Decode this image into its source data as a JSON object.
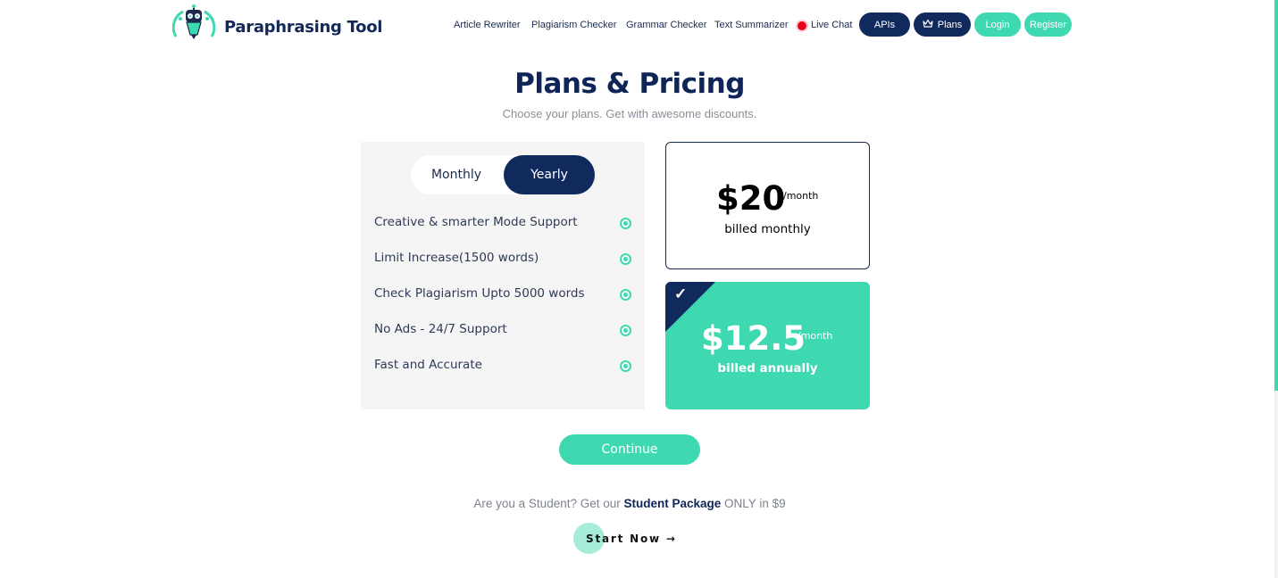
{
  "header": {
    "brand": "Paraphrasing Tool",
    "nav": [
      "Article Rewriter",
      "Plagiarism Checker",
      "Grammar Checker",
      "Text Summarizer"
    ],
    "live_chat": "Live Chat",
    "apis": "APIs",
    "plans": "Plans",
    "login": "Login",
    "register": "Register"
  },
  "hero": {
    "title": "Plans & Pricing",
    "subtitle": "Choose your plans. Get with awesome discounts."
  },
  "toggle": {
    "monthly": "Monthly",
    "yearly": "Yearly",
    "selected": "Yearly"
  },
  "features": [
    "Creative & smarter Mode Support",
    "Limit Increase(1500 words)",
    "Check Plagiarism Upto 5000 words",
    "No Ads - 24/7 Support",
    "Fast and Accurate"
  ],
  "plans": {
    "monthly": {
      "price": "$20",
      "per": "/month",
      "billed": "billed monthly"
    },
    "yearly": {
      "price": "$12.5",
      "per": "/month",
      "billed": "billed annually",
      "check": "✓"
    }
  },
  "continue_label": "Continue",
  "student": {
    "prefix": "Are you a Student? Get our ",
    "package": "Student Package",
    "suffix": " ONLY in $9",
    "cta": "Start Now →"
  },
  "colors": {
    "navy": "#112a5e",
    "teal": "#3ed8b1",
    "live": "#e8001c"
  },
  "icons": [
    "robot-logo-icon",
    "live-dot-icon",
    "crown-icon",
    "check-circle-icon",
    "checkmark-icon"
  ]
}
